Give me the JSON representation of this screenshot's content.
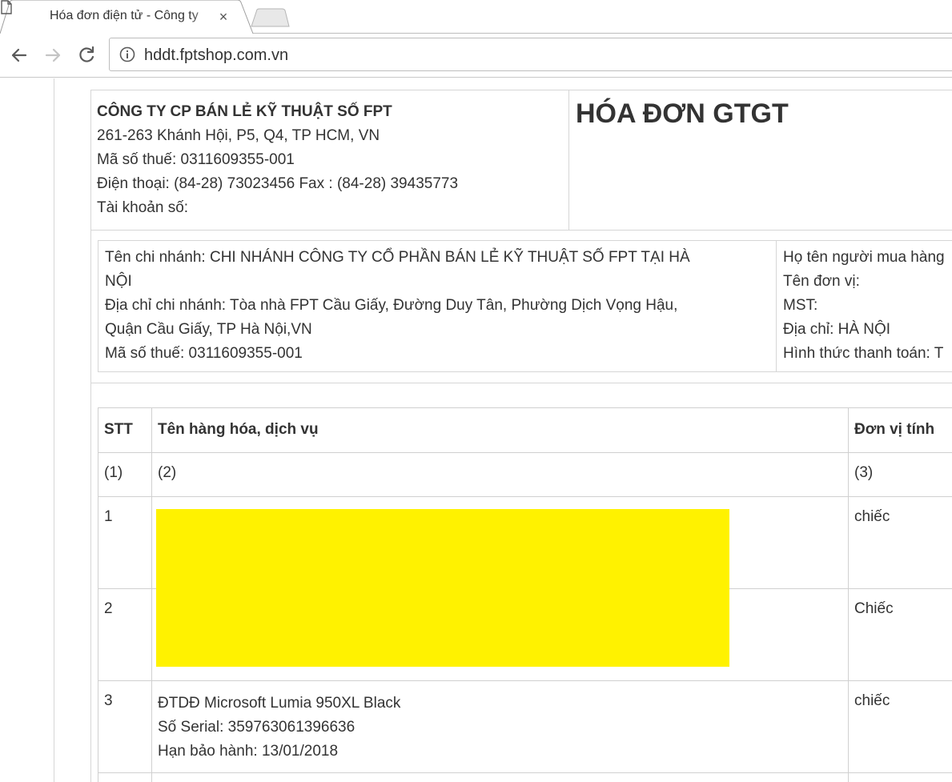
{
  "browser": {
    "tab_title": "Hóa đơn điện tử - Công ty",
    "url": "hddt.fptshop.com.vn",
    "icons": {
      "tab": "document-icon",
      "close": "close-icon",
      "back": "back-arrow-icon",
      "forward": "forward-arrow-icon",
      "reload": "reload-icon",
      "site_info": "info-icon"
    }
  },
  "invoice": {
    "title": "HÓA ĐƠN GTGT",
    "seller": {
      "name": "CÔNG TY CP BÁN LẺ KỸ THUẬT SỐ FPT",
      "address": "261-263 Khánh Hội, P5, Q4, TP HCM, VN",
      "tax_code": "Mã số thuế: 0311609355-001",
      "phone_fax": "Điện thoại: (84-28) 73023456 Fax : (84-28) 39435773",
      "account": "Tài khoản số:"
    },
    "branch": {
      "name_line1": "Tên chi nhánh: CHI NHÁNH CÔNG TY CỔ PHẦN BÁN LẺ KỸ THUẬT SỐ FPT TẠI HÀ",
      "name_line2": "NỘI",
      "address_line1": "Địa chỉ chi nhánh: Tòa nhà FPT Cầu Giấy, Đường Duy Tân, Phường Dịch Vọng Hậu,",
      "address_line2": "Quận Cầu Giấy, TP Hà Nội,VN",
      "tax_code": "Mã số thuế: 0311609355-001"
    },
    "buyer": {
      "name": "Họ tên người mua hàng",
      "unit": "Tên đơn vị:",
      "tax": "MST:",
      "address": "Địa chỉ: HÀ NỘI",
      "payment": "Hình thức thanh toán: T"
    },
    "table": {
      "headers": [
        "STT",
        "Tên hàng hóa, dịch vụ",
        "Đơn vị tính"
      ],
      "column_numbers": [
        "(1)",
        "(2)",
        "(3)"
      ],
      "rows": [
        {
          "stt": "1",
          "unit": "chiếc"
        },
        {
          "stt": "2",
          "unit": "Chiếc"
        },
        {
          "stt": "3",
          "name": "ĐTDĐ Microsoft Lumia 950XL Black",
          "serial": "Số Serial: 359763061396636",
          "warranty": "Hạn bảo hành: 13/01/2018",
          "unit": "chiếc"
        }
      ]
    },
    "redaction_color": "#fff200"
  }
}
